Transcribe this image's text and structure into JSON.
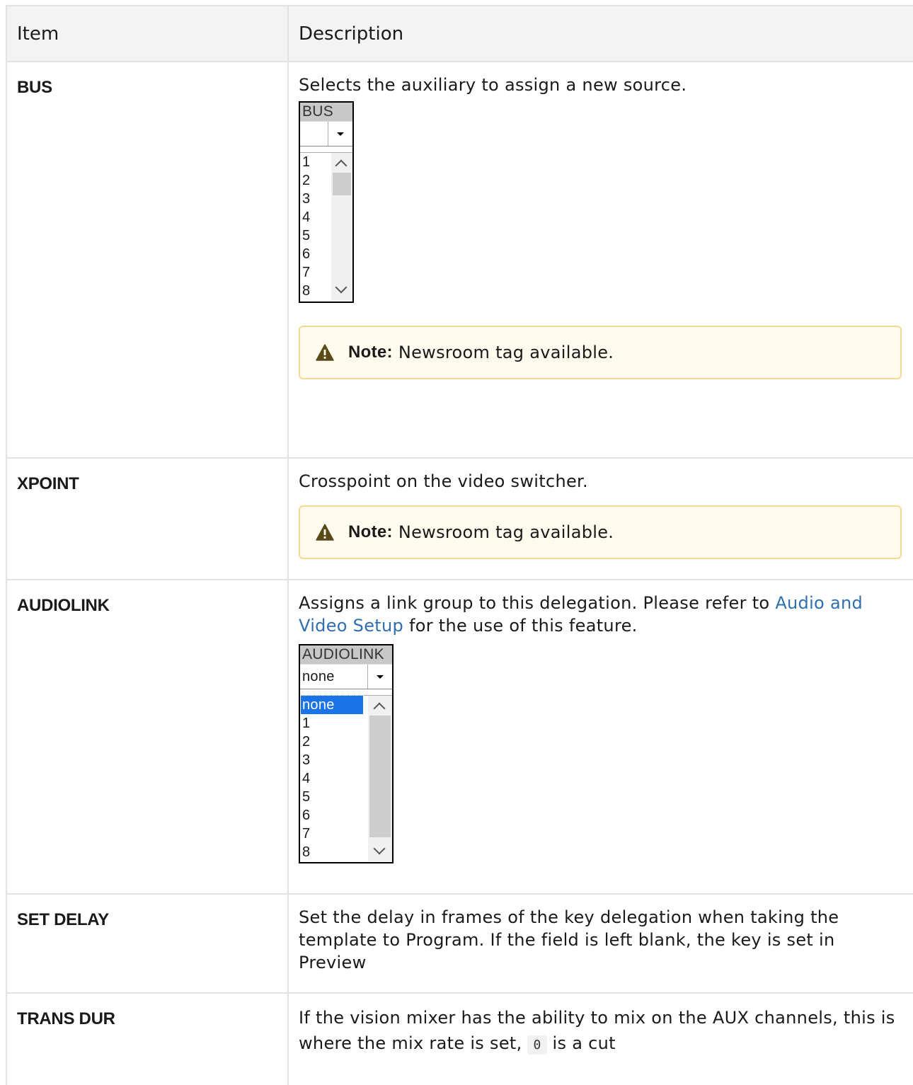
{
  "table": {
    "headers": [
      "Item",
      "Description"
    ],
    "rows": [
      {
        "item": "BUS",
        "desc": "Selects the auxiliary to assign a new source.",
        "note_label": "Note:",
        "note_text": "Newsroom tag available.",
        "widget": {
          "title": "BUS",
          "combo_value": "",
          "options": [
            "1",
            "2",
            "3",
            "4",
            "5",
            "6",
            "7",
            "8"
          ]
        }
      },
      {
        "item": "XPOINT",
        "desc": "Crosspoint on the video switcher.",
        "note_label": "Note:",
        "note_text": "Newsroom tag available."
      },
      {
        "item": "AUDIOLINK",
        "desc_before": "Assigns a link group to this delegation. Please refer to ",
        "link": "Audio and Video Setup",
        "desc_after": " for the use of this feature.",
        "widget": {
          "title": "AUDIOLINK",
          "combo_value": "none",
          "options": [
            "none",
            "1",
            "2",
            "3",
            "4",
            "5",
            "6",
            "7",
            "8"
          ],
          "selected": "none"
        }
      },
      {
        "item": "SET DELAY",
        "desc": "Set the delay in frames of the key delegation when taking the template to Program. If the field is left blank, the key is set in Preview"
      },
      {
        "item": "TRANS DUR",
        "desc_before": "If the vision mixer has the ability to mix on the AUX channels, this is where the mix rate is set, ",
        "code": "0",
        "desc_after": " is a cut"
      }
    ]
  },
  "icons": {
    "note_icon": "warning-triangle-icon",
    "note_icon_color": "#5a4a1a"
  },
  "colors": {
    "link": "#2f6fb0",
    "note_bg": "#fffaee",
    "note_border": "#f5d991",
    "header_bg": "#f3f3f3",
    "selection": "#1a73e8"
  }
}
